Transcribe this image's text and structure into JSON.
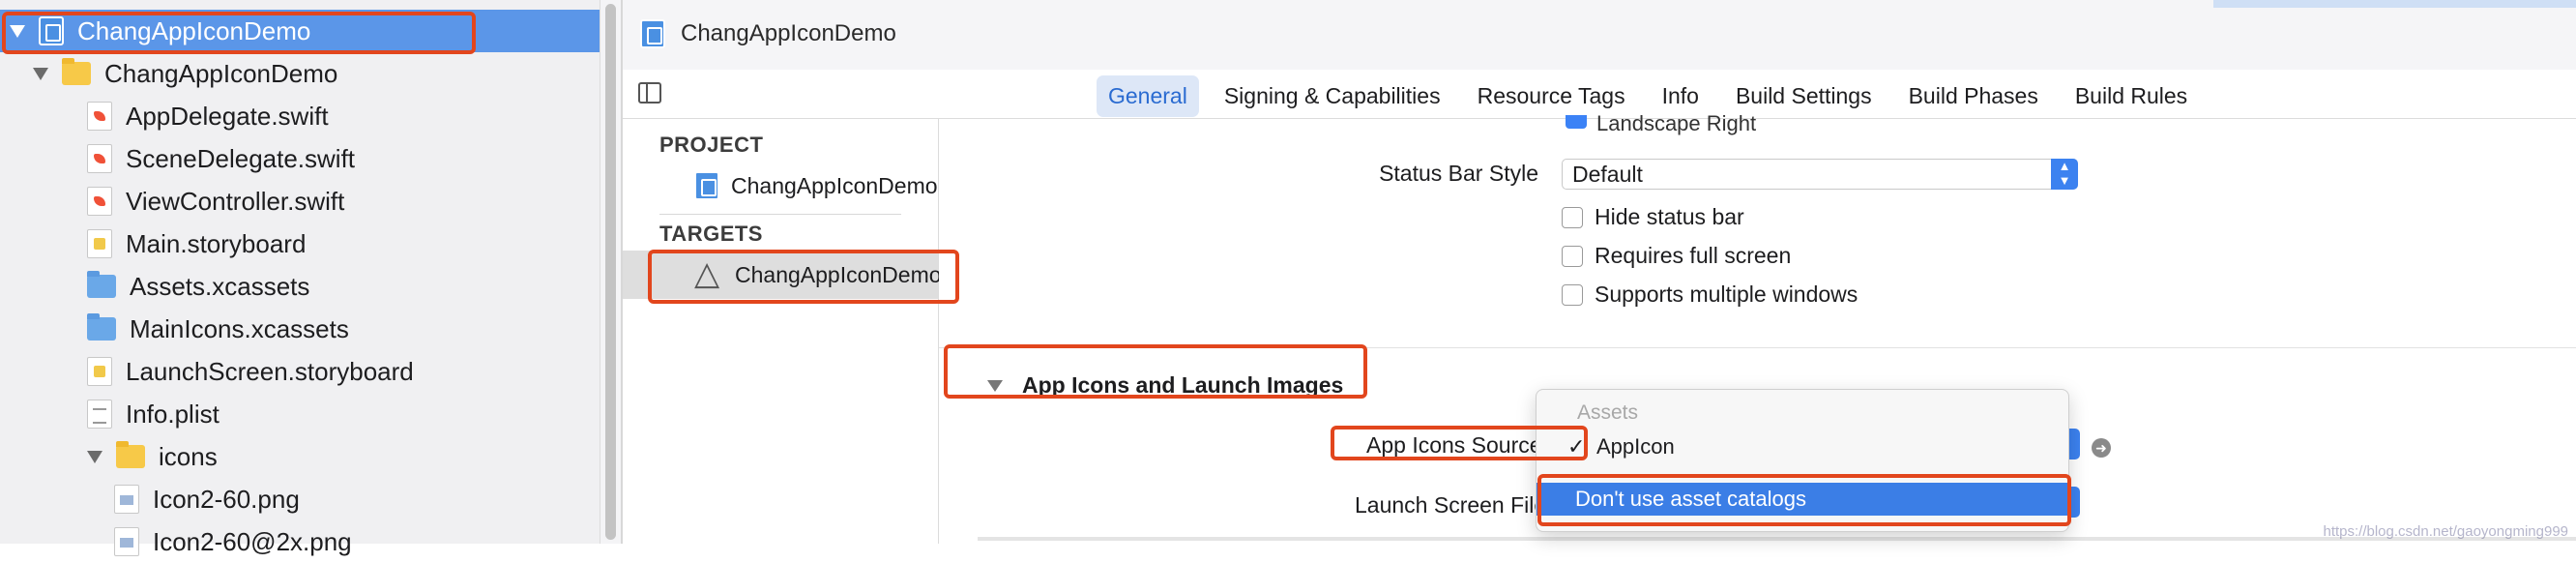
{
  "navigator": {
    "items": [
      {
        "label": "ChangAppIconDemo",
        "icon": "project-icon",
        "kind": "proj",
        "indent": 0,
        "disclosure": true,
        "selected": true
      },
      {
        "label": "ChangAppIconDemo",
        "icon": "folder-icon",
        "kind": "folder",
        "indent": 1,
        "disclosure": true
      },
      {
        "label": "AppDelegate.swift",
        "icon": "swift-file-icon",
        "kind": "doc swift",
        "indent": 2
      },
      {
        "label": "SceneDelegate.swift",
        "icon": "swift-file-icon",
        "kind": "doc swift",
        "indent": 2
      },
      {
        "label": "ViewController.swift",
        "icon": "swift-file-icon",
        "kind": "doc swift",
        "indent": 2
      },
      {
        "label": "Main.storyboard",
        "icon": "storyboard-file-icon",
        "kind": "doc sb",
        "indent": 2
      },
      {
        "label": "Assets.xcassets",
        "icon": "asset-catalog-icon",
        "kind": "xca",
        "indent": 2
      },
      {
        "label": "MainIcons.xcassets",
        "icon": "asset-catalog-icon",
        "kind": "xca",
        "indent": 2
      },
      {
        "label": "LaunchScreen.storyboard",
        "icon": "storyboard-file-icon",
        "kind": "doc sb",
        "indent": 2
      },
      {
        "label": "Info.plist",
        "icon": "plist-file-icon",
        "kind": "doc plist",
        "indent": 2
      },
      {
        "label": "icons",
        "icon": "folder-icon",
        "kind": "folder",
        "indent": 2,
        "disclosure": true
      },
      {
        "label": "Icon2-60.png",
        "icon": "image-file-icon",
        "kind": "doc png",
        "indent": 3
      },
      {
        "label": "Icon2-60@2x.png",
        "icon": "image-file-icon",
        "kind": "doc png",
        "indent": 3
      }
    ]
  },
  "editor": {
    "title": "ChangAppIconDemo",
    "tabs": [
      "General",
      "Signing & Capabilities",
      "Resource Tags",
      "Info",
      "Build Settings",
      "Build Phases",
      "Build Rules"
    ],
    "active_tab": "General"
  },
  "targets_panel": {
    "project_header": "PROJECT",
    "project_item": "ChangAppIconDemo",
    "targets_header": "TARGETS",
    "target_item": "ChangAppIconDemo"
  },
  "settings": {
    "cut_off_text": "Landscape Right",
    "status_bar_style_label": "Status Bar Style",
    "status_bar_style_value": "Default",
    "checkboxes": [
      "Hide status bar",
      "Requires full screen",
      "Supports multiple windows"
    ],
    "section_title": "App Icons and Launch Images",
    "app_icons_source_label": "App Icons Source",
    "launch_screen_label": "Launch Screen File"
  },
  "dropdown": {
    "header": "Assets",
    "checked_item": "AppIcon",
    "highlighted_item": "Don't use asset catalogs"
  },
  "colors": {
    "selection_blue": "#5b96e8",
    "annotation_red": "#e2461d",
    "menu_highlight": "#3b7ee6"
  },
  "watermark": "https://blog.csdn.net/gaoyongming999"
}
